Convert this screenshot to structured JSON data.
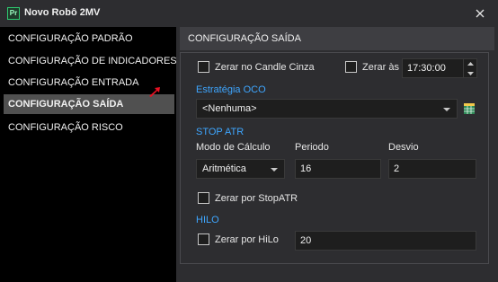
{
  "window": {
    "app_icon_text": "Pr",
    "title": "Novo Robô 2MV",
    "close_icon": "close-icon"
  },
  "sidebar": {
    "items": [
      {
        "label": "CONFIGURAÇÃO PADRÃO",
        "active": false
      },
      {
        "label": "CONFIGURAÇÃO DE INDICADORES",
        "active": false
      },
      {
        "label": "CONFIGURAÇÃO ENTRADA",
        "active": false
      },
      {
        "label": "CONFIGURAÇÃO SAÍDA",
        "active": true
      },
      {
        "label": "CONFIGURAÇÃO RISCO",
        "active": false
      }
    ],
    "marker_icon": "red-arrow-icon"
  },
  "main": {
    "header": "CONFIGURAÇÃO SAÍDA",
    "zerar_candle_cinza": {
      "label": "Zerar no Candle Cinza",
      "checked": false
    },
    "zerar_as": {
      "label": "Zerar às",
      "checked": false,
      "time": "17:30:00"
    },
    "estrategia_oco": {
      "title": "Estratégia OCO",
      "selected": "<Nenhuma>",
      "icon": "save-table-icon"
    },
    "stop_atr": {
      "title": "STOP ATR",
      "modo_label": "Modo de Cálculo",
      "modo_value": "Aritmética",
      "periodo_label": "Periodo",
      "periodo_value": "16",
      "desvio_label": "Desvio",
      "desvio_value": "2",
      "zerar_label": "Zerar por StopATR",
      "zerar_checked": false
    },
    "hilo": {
      "title": "HILO",
      "zerar_label": "Zerar por HiLo",
      "zerar_checked": false,
      "value": "20"
    }
  },
  "colors": {
    "accent_blue": "#3ea6ff",
    "background": "#2d2d30",
    "sidebar_bg": "#000000",
    "active_item": "#505050",
    "marker_red": "#e81123"
  }
}
